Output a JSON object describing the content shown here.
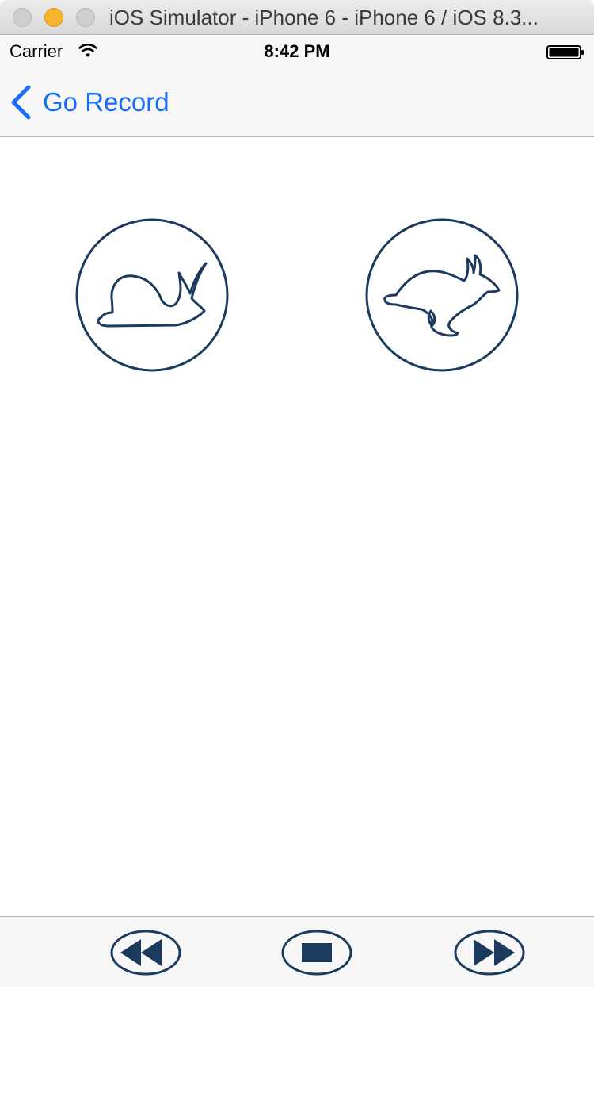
{
  "window": {
    "title": "iOS Simulator - iPhone 6 - iPhone 6 / iOS 8.3..."
  },
  "status_bar": {
    "carrier": "Carrier",
    "time": "8:42 PM"
  },
  "nav_bar": {
    "back_label": "Go Record"
  },
  "content": {
    "slow_icon": "snail-icon",
    "fast_icon": "rabbit-icon"
  },
  "toolbar": {
    "icons": [
      "rewind-icon",
      "stop-icon",
      "fast-forward-icon"
    ]
  },
  "colors": {
    "tint": "#1a6dfb",
    "icon_navy": "#1c3a5e",
    "bar_background": "#f7f7f7"
  }
}
